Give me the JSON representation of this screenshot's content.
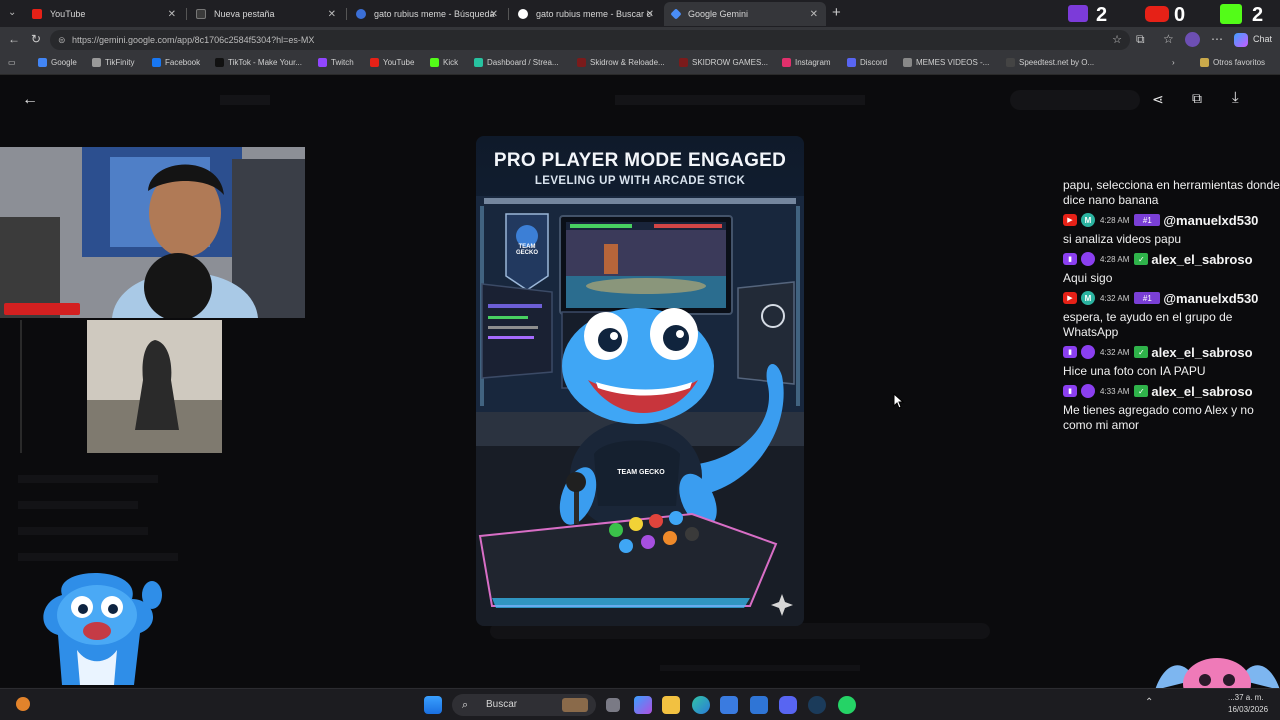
{
  "tabs": [
    {
      "title": "YouTube",
      "color": "#e62117"
    },
    {
      "title": "Nueva pestaña",
      "color": "#3a3a3a"
    },
    {
      "title": "gato rubius meme - Búsqueda",
      "color": "#3b6fd6"
    },
    {
      "title": "gato rubius meme - Buscar con G...",
      "color": "#ffffff"
    },
    {
      "title": "Google Gemini",
      "color": "#4a8df6"
    }
  ],
  "counters": {
    "twitch": "2",
    "youtube": "0",
    "kick": "2"
  },
  "address": {
    "url": "https://gemini.google.com/app/8c1706c2584f5304?hl=es-MX"
  },
  "bookmarks": [
    {
      "label": "Google",
      "color": "#4285f4"
    },
    {
      "label": "TikFinity",
      "color": "#999999"
    },
    {
      "label": "Facebook",
      "color": "#1877f2"
    },
    {
      "label": "TikTok - Make Your...",
      "color": "#111111"
    },
    {
      "label": "Twitch",
      "color": "#9146ff"
    },
    {
      "label": "YouTube",
      "color": "#e62117"
    },
    {
      "label": "Kick",
      "color": "#53fc18"
    },
    {
      "label": "Dashboard / Strea...",
      "color": "#27c2a0"
    },
    {
      "label": "Skidrow & Reloade...",
      "color": "#7a1b1b"
    },
    {
      "label": "SKIDROW GAMES...",
      "color": "#7a1b1b"
    },
    {
      "label": "Instagram",
      "color": "#e1306c"
    },
    {
      "label": "Discord",
      "color": "#5865f2"
    },
    {
      "label": "MEMES VIDEOS -...",
      "color": "#888888"
    },
    {
      "label": "Speedtest.net by O...",
      "color": "#444444"
    }
  ],
  "other_bookmarks": "Otros favoritos",
  "browser_chat": "Chat",
  "generated_image": {
    "headline": "PRO PLAYER MODE ENGAGED",
    "subline": "LEVELING UP WITH ARCADE STICK",
    "banner_text": "TEAM GECKO",
    "jersey_text": "TEAM GECKO"
  },
  "chat": [
    {
      "text": "papu, selecciona en herramientas donde dice nano banana"
    },
    {
      "platform": "youtube",
      "avatar": "M",
      "avatar_color": "#2bb3a0",
      "time": "4:28 AM",
      "badge": "#1",
      "user": "@manuelxd530",
      "text": "si analiza videos papu"
    },
    {
      "platform": "twitch",
      "avatar": "",
      "avatar_color": "#8b3ff0",
      "time": "4:28 AM",
      "badge": "check",
      "user": "alex_el_sabroso",
      "text": "Aqui sigo"
    },
    {
      "platform": "youtube",
      "avatar": "M",
      "avatar_color": "#2bb3a0",
      "time": "4:32 AM",
      "badge": "#1",
      "user": "@manuelxd530",
      "text": "espera, te ayudo en el grupo de WhatsApp"
    },
    {
      "platform": "twitch",
      "avatar": "",
      "avatar_color": "#8b3ff0",
      "time": "4:32 AM",
      "badge": "check",
      "user": "alex_el_sabroso",
      "text": "Hice una foto con IA PAPU"
    },
    {
      "platform": "twitch",
      "avatar": "",
      "avatar_color": "#8b3ff0",
      "time": "4:33 AM",
      "badge": "check",
      "user": "alex_el_sabroso",
      "text": "Me tienes agregado como Alex y no como mi amor"
    }
  ],
  "taskbar": {
    "search": "Buscar",
    "clock_time": "...37 a. m.",
    "clock_date": "16/03/2026"
  }
}
